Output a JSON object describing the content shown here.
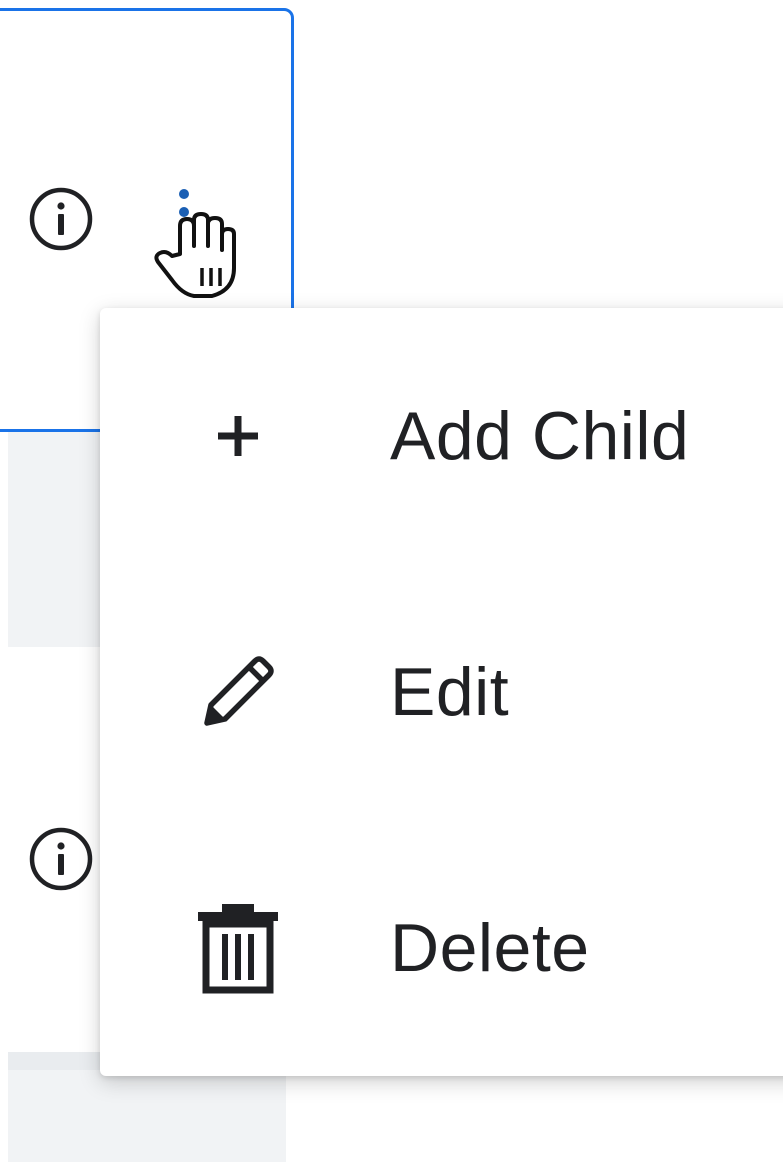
{
  "menu": {
    "items": [
      {
        "label": "Add Child",
        "icon": "plus-icon"
      },
      {
        "label": "Edit",
        "icon": "pencil-icon"
      },
      {
        "label": "Delete",
        "icon": "trash-icon"
      }
    ]
  },
  "colors": {
    "accent": "#1a73e8",
    "text": "#202124",
    "row_alt": "#f1f3f5"
  },
  "icons": {
    "info": "info-icon",
    "more": "more-vertical-icon",
    "cursor": "hand-cursor-icon"
  }
}
